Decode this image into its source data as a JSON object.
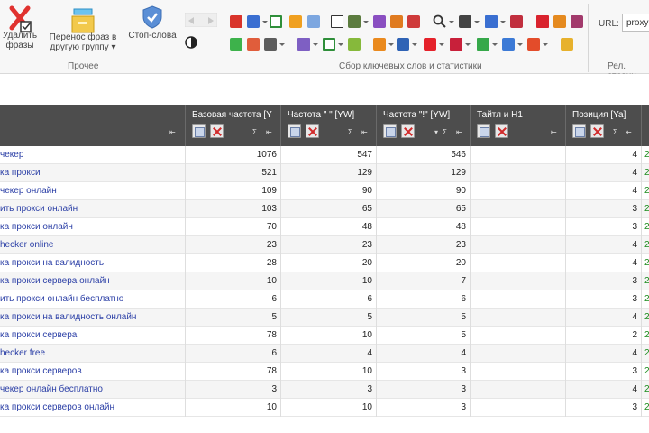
{
  "ribbon": {
    "delete_label": "Удалить\nфразы",
    "move_label": "Перенос фраз в\nдругую группу ▾",
    "stop_label": "Стоп-слова",
    "group_misc": "Прочее",
    "group_collect": "Сбор ключевых слов и статистики",
    "group_rel": "Рел. страни",
    "url_label": "URL:",
    "url_value": "proxy"
  },
  "columns": [
    {
      "title": ""
    },
    {
      "title": "Базовая частота [Y"
    },
    {
      "title": "Частота \" \" [YW]"
    },
    {
      "title": "Частота \"!\" [YW]"
    },
    {
      "title": "Тайтл и H1"
    },
    {
      "title": "Позиция [Ya]"
    }
  ],
  "rows": [
    {
      "phrase": "чекер",
      "base": "1076",
      "quote": "547",
      "excl": "546",
      "pos": "4",
      "extra": "2"
    },
    {
      "phrase": "ка прокси",
      "base": "521",
      "quote": "129",
      "excl": "129",
      "pos": "4",
      "extra": "2"
    },
    {
      "phrase": "чекер онлайн",
      "base": "109",
      "quote": "90",
      "excl": "90",
      "pos": "4",
      "extra": "2"
    },
    {
      "phrase": "ить прокси онлайн",
      "base": "103",
      "quote": "65",
      "excl": "65",
      "pos": "3",
      "extra": "2"
    },
    {
      "phrase": "ка прокси онлайн",
      "base": "70",
      "quote": "48",
      "excl": "48",
      "pos": "3",
      "extra": "2"
    },
    {
      "phrase": "hecker online",
      "base": "23",
      "quote": "23",
      "excl": "23",
      "pos": "4",
      "extra": "2"
    },
    {
      "phrase": "ка прокси на валидность",
      "base": "28",
      "quote": "20",
      "excl": "20",
      "pos": "4",
      "extra": "2"
    },
    {
      "phrase": "ка прокси сервера онлайн",
      "base": "10",
      "quote": "10",
      "excl": "7",
      "pos": "3",
      "extra": "2"
    },
    {
      "phrase": "ить прокси онлайн бесплатно",
      "base": "6",
      "quote": "6",
      "excl": "6",
      "pos": "3",
      "extra": "2"
    },
    {
      "phrase": "ка прокси на валидность онлайн",
      "base": "5",
      "quote": "5",
      "excl": "5",
      "pos": "4",
      "extra": "2"
    },
    {
      "phrase": "ка прокси сервера",
      "base": "78",
      "quote": "10",
      "excl": "5",
      "pos": "2",
      "extra": "2"
    },
    {
      "phrase": "hecker free",
      "base": "6",
      "quote": "4",
      "excl": "4",
      "pos": "4",
      "extra": "2"
    },
    {
      "phrase": "ка прокси серверов",
      "base": "78",
      "quote": "10",
      "excl": "3",
      "pos": "3",
      "extra": "2"
    },
    {
      "phrase": "чекер онлайн бесплатно",
      "base": "3",
      "quote": "3",
      "excl": "3",
      "pos": "4",
      "extra": "2"
    },
    {
      "phrase": "ка прокси серверов онлайн",
      "base": "10",
      "quote": "10",
      "excl": "3",
      "pos": "3",
      "extra": "2"
    }
  ]
}
